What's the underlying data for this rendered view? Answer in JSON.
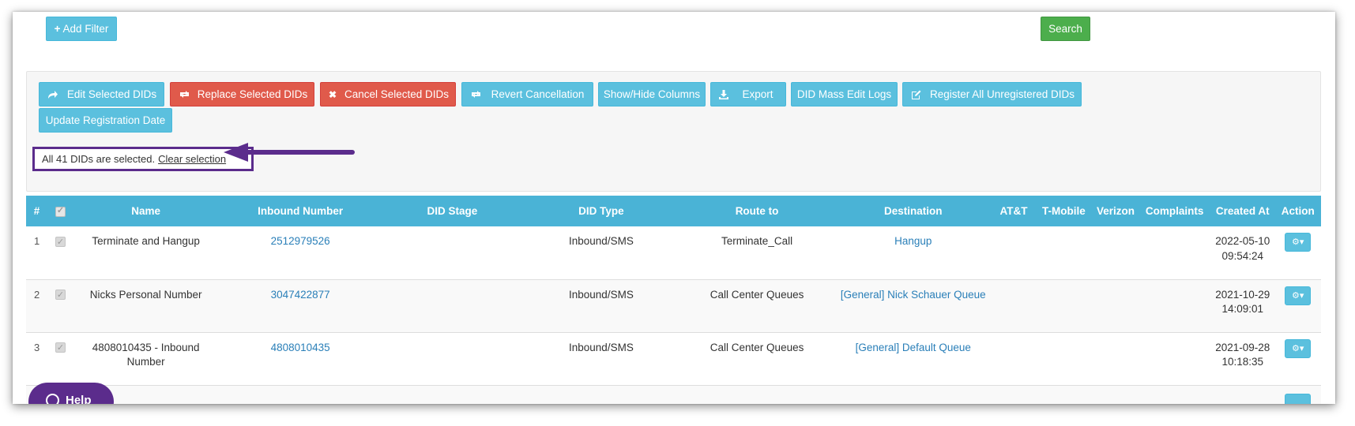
{
  "toolbar_top": {
    "add_filter_label": "Add Filter",
    "search_label": "Search"
  },
  "actions": {
    "edit_selected": "Edit Selected DIDs",
    "replace_selected": "Replace Selected DIDs",
    "cancel_selected": "Cancel Selected DIDs",
    "revert_cancellation": "Revert Cancellation",
    "show_hide_columns": "Show/Hide Columns",
    "export": "Export",
    "mass_edit_logs": "DID Mass Edit Logs",
    "register_all": "Register All Unregistered DIDs",
    "update_registration_date": "Update Registration Date"
  },
  "selection": {
    "text": "All 41 DIDs are selected.",
    "clear_link": "Clear selection"
  },
  "table": {
    "headers": [
      "#",
      "",
      "Name",
      "Inbound Number",
      "DID Stage",
      "DID Type",
      "Route to",
      "Destination",
      "AT&T",
      "T-Mobile",
      "Verizon",
      "Complaints",
      "Created At",
      "Action"
    ],
    "rows": [
      {
        "idx": "1",
        "name": "Terminate and Hangup",
        "number": "2512979526",
        "stage": "",
        "type": "Inbound/SMS",
        "route": "Terminate_Call",
        "destination": "Hangup",
        "created": "2022-05-10 09:54:24"
      },
      {
        "idx": "2",
        "name": "Nicks Personal Number",
        "number": "3047422877",
        "stage": "",
        "type": "Inbound/SMS",
        "route": "Call Center Queues",
        "destination": "[General] Nick Schauer Queue",
        "created": "2021-10-29 14:09:01"
      },
      {
        "idx": "3",
        "name": "4808010435 - Inbound Number",
        "number": "4808010435",
        "stage": "",
        "type": "Inbound/SMS",
        "route": "Call Center Queues",
        "destination": "[General] Default Queue",
        "created": "2021-09-28 10:18:35"
      }
    ]
  },
  "help": {
    "label": "Help"
  },
  "colors": {
    "info": "#5bc0de",
    "danger": "#e05a4b",
    "success": "#4cae4c",
    "header": "#4ab3d6",
    "highlight": "#5b2c8c",
    "link": "#2a7fb8"
  },
  "icons": {
    "add_filter": "plus-icon",
    "edit": "share-arrow-icon",
    "replace": "retweet-icon",
    "cancel": "close-icon",
    "revert": "retweet-icon",
    "export": "download-icon",
    "register": "edit-icon",
    "action": "gear-icon",
    "help": "chat-icon",
    "annotation": "arrow-left-icon"
  }
}
